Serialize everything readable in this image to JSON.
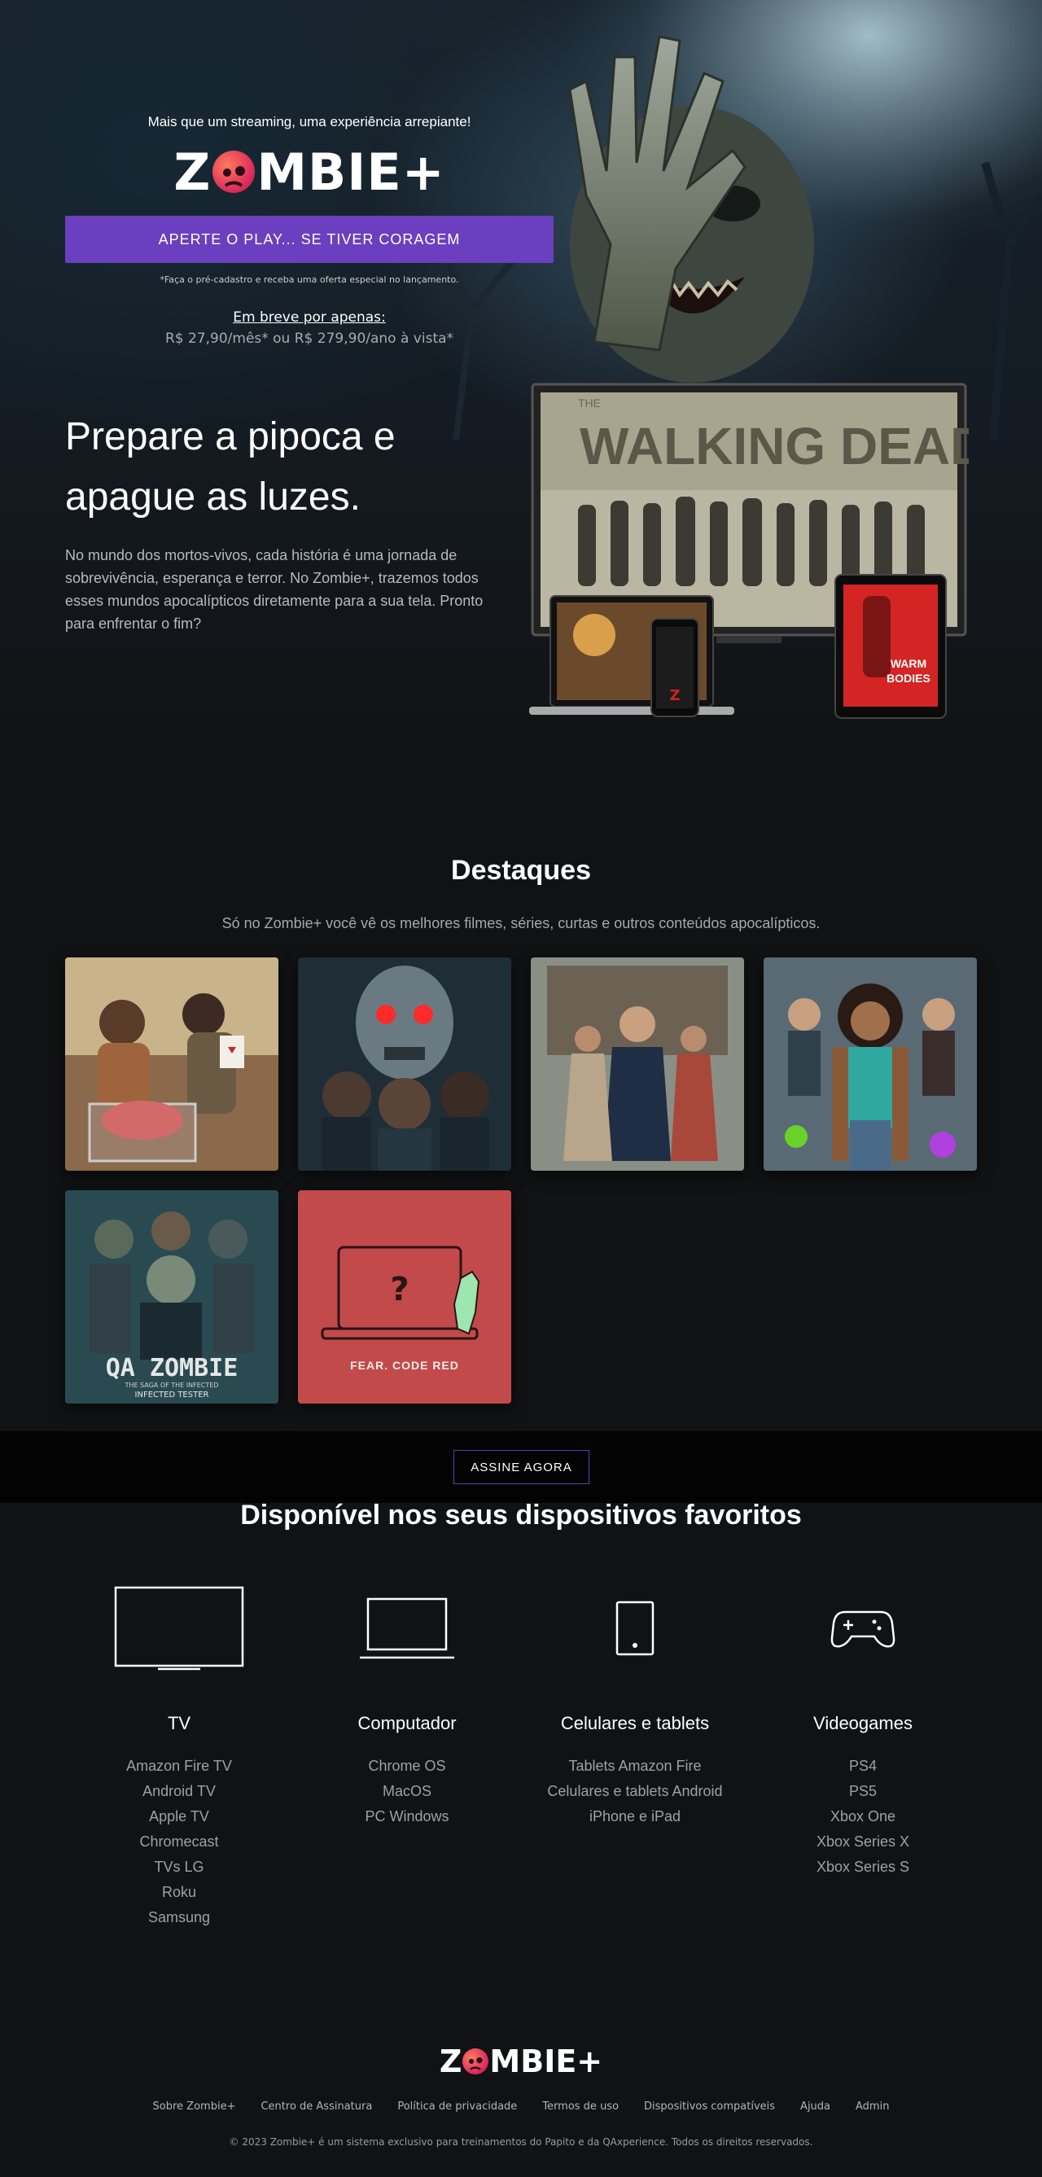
{
  "hero": {
    "tagline": "Mais que um streaming, uma experiência arrepiante!",
    "logo_prefix": "Z",
    "logo_suffix": "MBIE+",
    "cta": "APERTE O PLAY... SE TIVER CORAGEM",
    "note": "*Faça o pré-cadastro e receba uma oferta especial no lançamento.",
    "soon": "Em breve por apenas:",
    "price": "R$ 27,90/mês* ou R$ 279,90/ano à vista*"
  },
  "intro": {
    "title_line1": "Prepare a pipoca e",
    "title_line2": "apague as luzes.",
    "text": "No mundo dos mortos-vivos, cada história é uma jornada de sobrevivência, esperança e terror. No Zombie+, trazemos todos esses mundos apocalípticos diretamente para a sua tela. Pronto para enfrentar o fim?",
    "tv_title": "WALKING DEAD",
    "tv_sup": "THE",
    "tablet_title1": "WARM",
    "tablet_title2": "BODIES"
  },
  "highlights": {
    "title": "Destaques",
    "subtitle": "Só no Zombie+ você vê os melhores filmes, séries, curtas e outros conteúdos apocalípticos.",
    "cards": [
      {
        "name": "card-1"
      },
      {
        "name": "card-2"
      },
      {
        "name": "card-3"
      },
      {
        "name": "card-4"
      },
      {
        "name": "card-5",
        "title": "QA ZOMBIE",
        "subtitle": "THE SAGA OF THE INFECTED",
        "subtitle2": "INFECTED TESTER"
      },
      {
        "name": "card-6",
        "title": "FEAR. CODE RED"
      }
    ]
  },
  "band": {
    "cta": "ASSINE AGORA"
  },
  "devices": {
    "title": "Disponível nos seus dispositivos favoritos",
    "columns": [
      {
        "title": "TV",
        "icon": "tv-icon",
        "items": [
          "Amazon Fire TV",
          "Android TV",
          "Apple TV",
          "Chromecast",
          "TVs LG",
          "Roku",
          "Samsung"
        ]
      },
      {
        "title": "Computador",
        "icon": "laptop-icon",
        "items": [
          "Chrome OS",
          "MacOS",
          "PC Windows"
        ]
      },
      {
        "title": "Celulares e tablets",
        "icon": "tablet-icon",
        "items": [
          "Tablets Amazon Fire",
          "Celulares e tablets Android",
          "iPhone e iPad"
        ]
      },
      {
        "title": "Videogames",
        "icon": "gamepad-icon",
        "items": [
          "PS4",
          "PS5",
          "Xbox One",
          "Xbox Series X",
          "Xbox Series S"
        ]
      }
    ]
  },
  "footer": {
    "logo_prefix": "Z",
    "logo_suffix": "MBIE+",
    "links": [
      "Sobre Zombie+",
      "Centro de Assinatura",
      "Política de privacidade",
      "Termos de uso",
      "Dispositivos compatíveis",
      "Ajuda",
      "Admin"
    ],
    "copyright": "© 2023 Zombie+ é um sistema exclusivo para treinamentos do Papito e da QAxperience. Todos os direitos reservados."
  },
  "colors": {
    "accent": "#6b3fbf",
    "background": "#111214",
    "badge": "#e0325e"
  }
}
